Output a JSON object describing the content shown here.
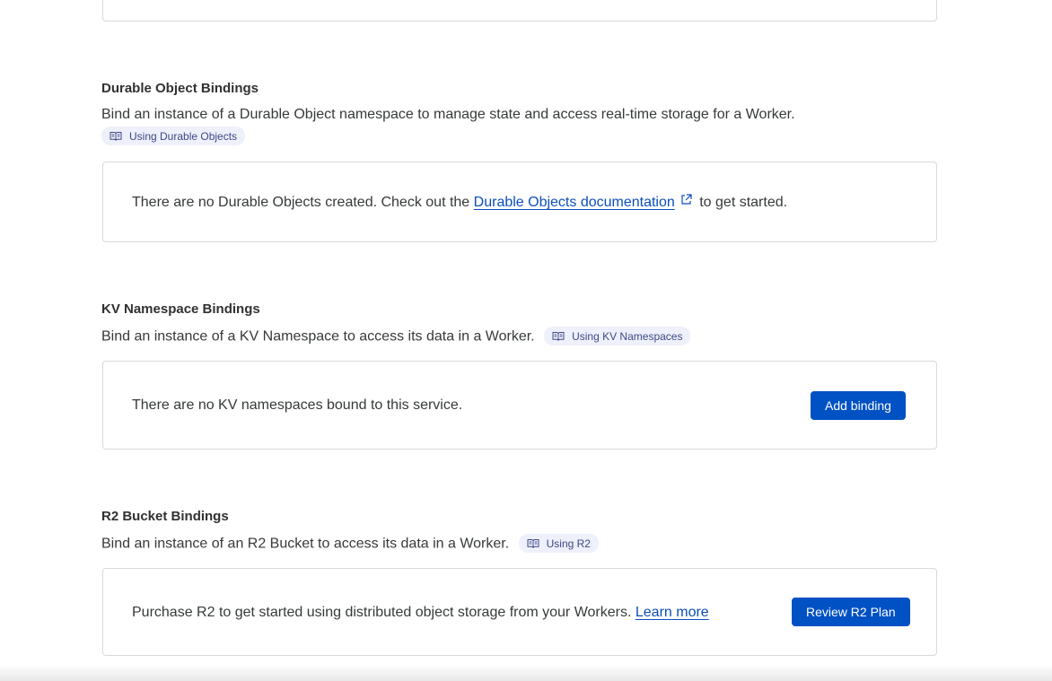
{
  "durable_objects": {
    "title": "Durable Object Bindings",
    "description": "Bind an instance of a Durable Object namespace to manage state and access real-time storage for a Worker.",
    "doc_pill": "Using Durable Objects",
    "empty_prefix": "There are no Durable Objects created. Check out the",
    "empty_link": "Durable Objects documentation",
    "empty_suffix": "to get started."
  },
  "kv": {
    "title": "KV Namespace Bindings",
    "description": "Bind an instance of a KV Namespace to access its data in a Worker.",
    "doc_pill": "Using KV Namespaces",
    "empty_text": "There are no KV namespaces bound to this service.",
    "button": "Add binding"
  },
  "r2": {
    "title": "R2 Bucket Bindings",
    "description": "Bind an instance of an R2 Bucket to access its data in a Worker.",
    "doc_pill": "Using R2",
    "empty_text": "Purchase R2 to get started using distributed object storage from your Workers.",
    "learn_more": "Learn more",
    "button": "Review R2 Plan"
  },
  "icons": {
    "doc": "book-icon",
    "external": "external-link-icon"
  },
  "colors": {
    "primary_button": "#0051c3",
    "link": "#0b4eb9",
    "pill_bg": "#eef0fb",
    "pill_text": "#3d4a84",
    "card_border": "#d9d9d9"
  }
}
